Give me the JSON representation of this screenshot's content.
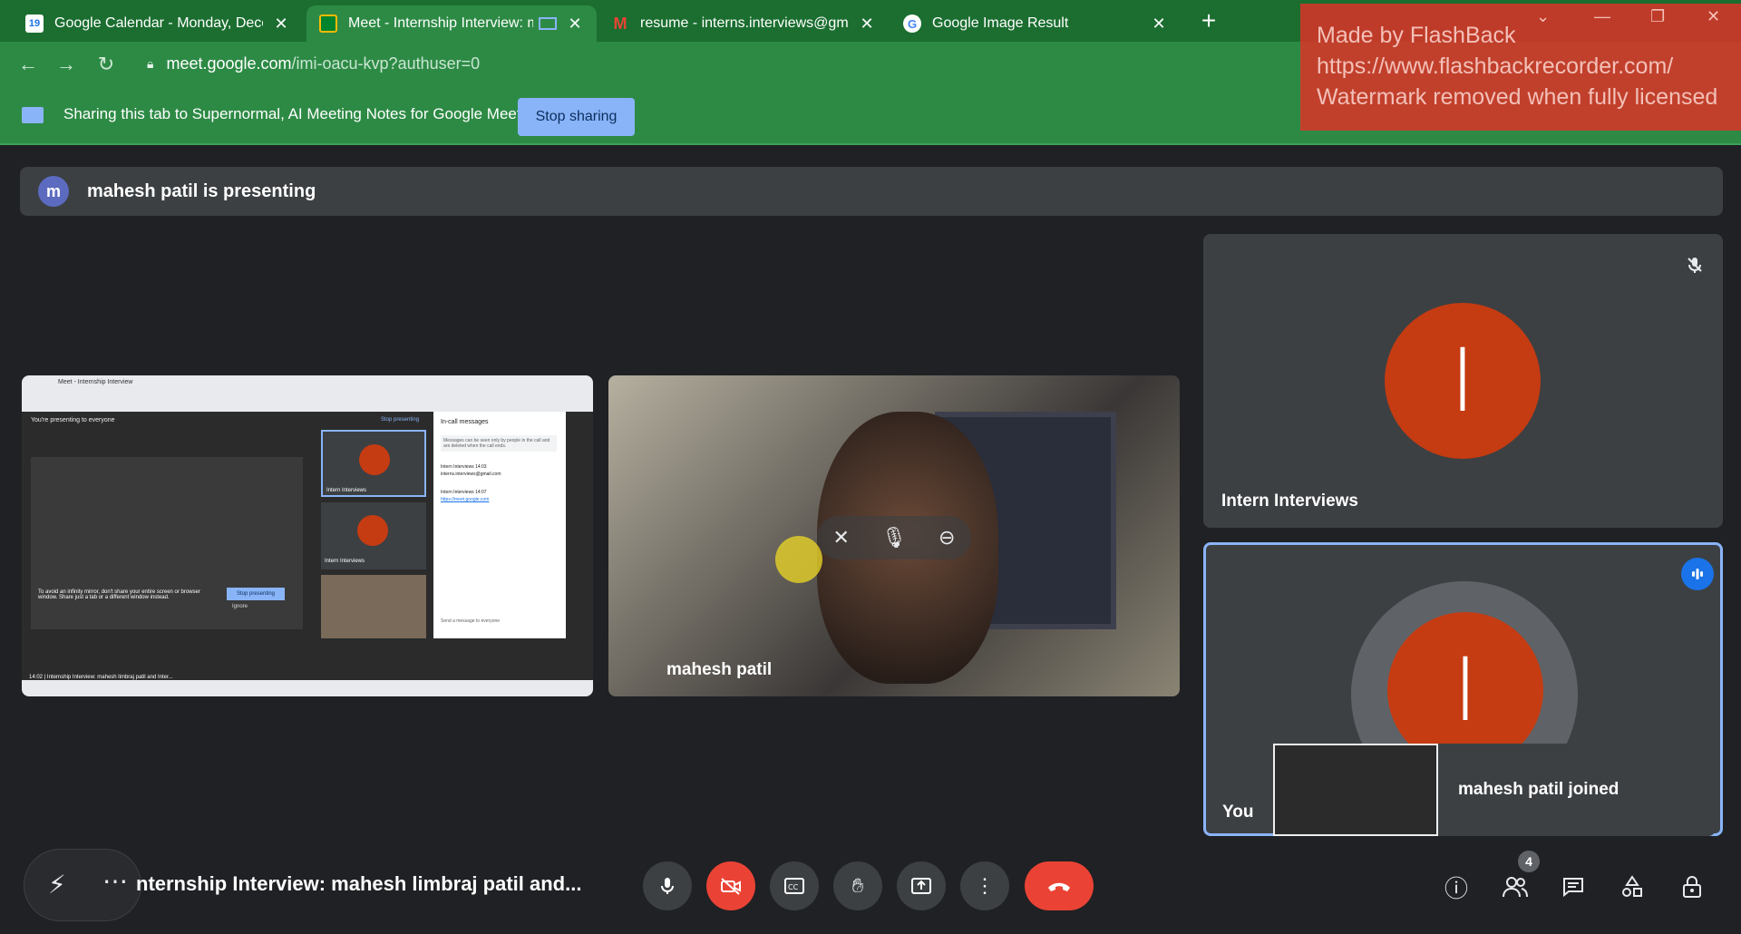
{
  "browser": {
    "tabs": [
      {
        "title": "Google Calendar - Monday, Decemb",
        "fav": "19"
      },
      {
        "title": "Meet - Internship Interview: ma",
        "fav": ""
      },
      {
        "title": "resume - interns.interviews@gmail.c",
        "fav": "M"
      },
      {
        "title": "Google Image Result",
        "fav": "G"
      }
    ],
    "url_host": "meet.google.com",
    "url_path": "/imi-oacu-kvp?authuser=0",
    "new_tab": "+"
  },
  "infobar": {
    "message": "Sharing this tab to Supernormal, AI Meeting Notes for Google Meet",
    "stop_label": "Stop sharing"
  },
  "watermark": {
    "line1": "Made by FlashBack",
    "line2": "https://www.flashbackrecorder.com/",
    "line3": "Watermark removed when fully licensed"
  },
  "meet": {
    "presenting_avatar": "m",
    "presenting_text": "mahesh patil is presenting",
    "camera_tile_name": "mahesh patil",
    "intern_tile_name": "Intern Interviews",
    "intern_avatar": "I",
    "you_tile_name": "You",
    "you_avatar": "I",
    "joined_text": "mahesh patil joined",
    "meeting_title": "nternship Interview: mahesh limbraj patil and...",
    "people_count": "4",
    "shared_screen": {
      "tab_title": "Meet - Internship Interview",
      "presenting_banner": "You're presenting to everyone",
      "stop_presenting": "Stop presenting",
      "chat_title": "In-call messages",
      "chat_info": "Messages can be seen only by people in the call and are deleted when the call ends.",
      "msg1_sender": "Intern Interviews",
      "msg1_time": "14:03",
      "msg1_text": "interns.interviews@gmail.com",
      "msg2_sender": "Intern Interviews",
      "msg2_time": "14:07",
      "msg2_text": "https://meet.google.com",
      "send_placeholder": "Send a message to everyone",
      "mirror_warning": "To avoid an infinity mirror, don't share your entire screen or browser window. Share just a tab or a different window instead.",
      "stop_sharing": "Stop presenting",
      "ignore": "Ignore",
      "footer": "14:02 | Internship Interview: mahesh limbraj patil and Inter...",
      "intern_label": "Intern Interviews"
    }
  },
  "colors": {
    "browser_green": "#2d8a45",
    "meet_bg": "#202124",
    "tile_bg": "#3c4043",
    "avatar_orange": "#c53b12",
    "end_call_red": "#ea4335",
    "accent_blue": "#8ab4f8"
  }
}
